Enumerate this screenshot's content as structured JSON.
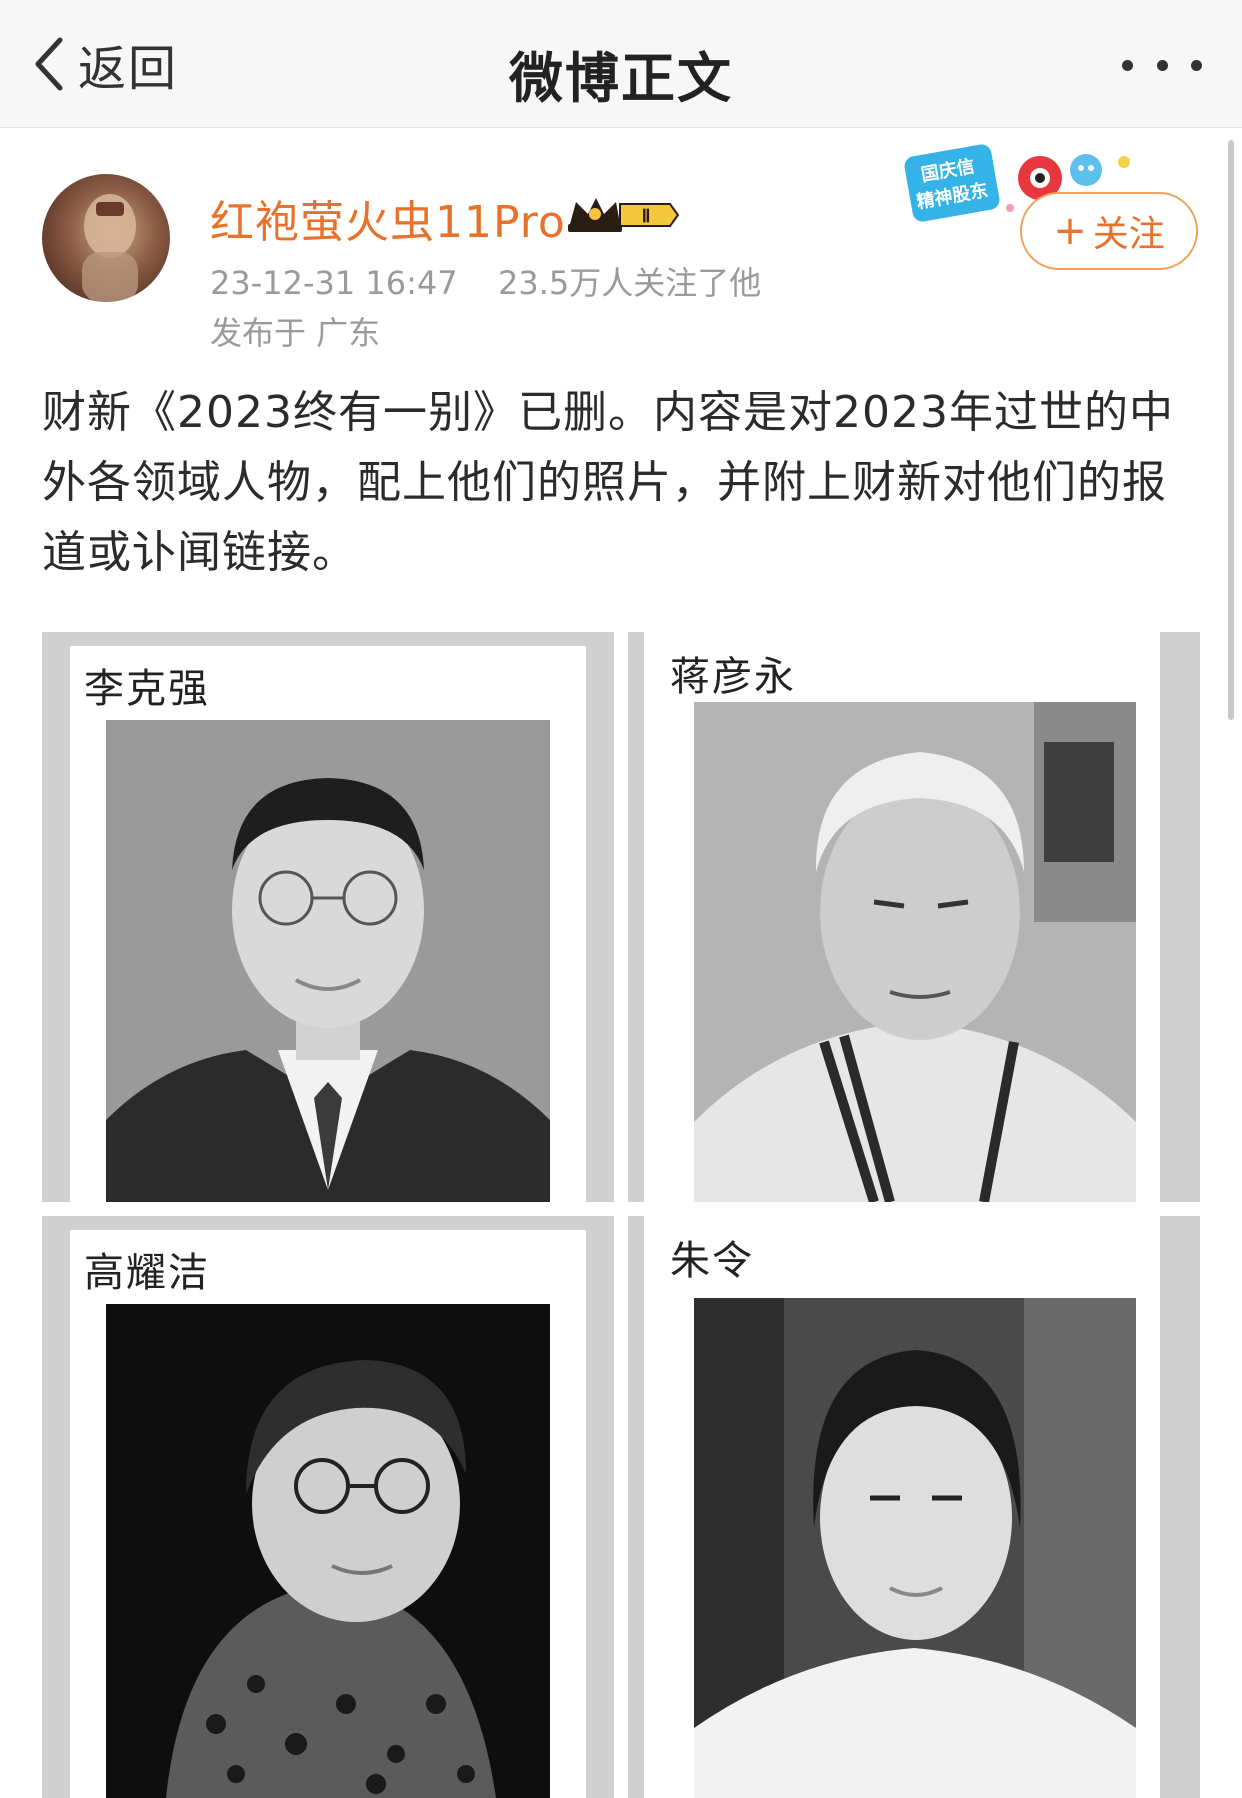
{
  "nav": {
    "back_label": "返回",
    "title": "微博正文"
  },
  "post": {
    "username": "红袍萤火虫11Pro",
    "vip_level": "Ⅱ",
    "time": "23-12-31 16:47",
    "followers": "23.5万人关注了他",
    "location": "发布于 广东",
    "follow_label": "关注",
    "badge_text": [
      "国庆信",
      "精神股东"
    ],
    "text": "财新《2023终有一别》已删。内容是对2023年过世的中外各领域人物，配上他们的照片，并附上财新对他们的报道或讣闻链接。"
  },
  "images": [
    {
      "name": "李克强"
    },
    {
      "name": "蒋彦永"
    },
    {
      "name": "高耀洁"
    },
    {
      "name": "朱令"
    }
  ],
  "colors": {
    "accent": "#e8722b",
    "follow_border": "#f0a25c",
    "meta": "#9a9a9a",
    "nav_bg": "#f7f7f7"
  }
}
